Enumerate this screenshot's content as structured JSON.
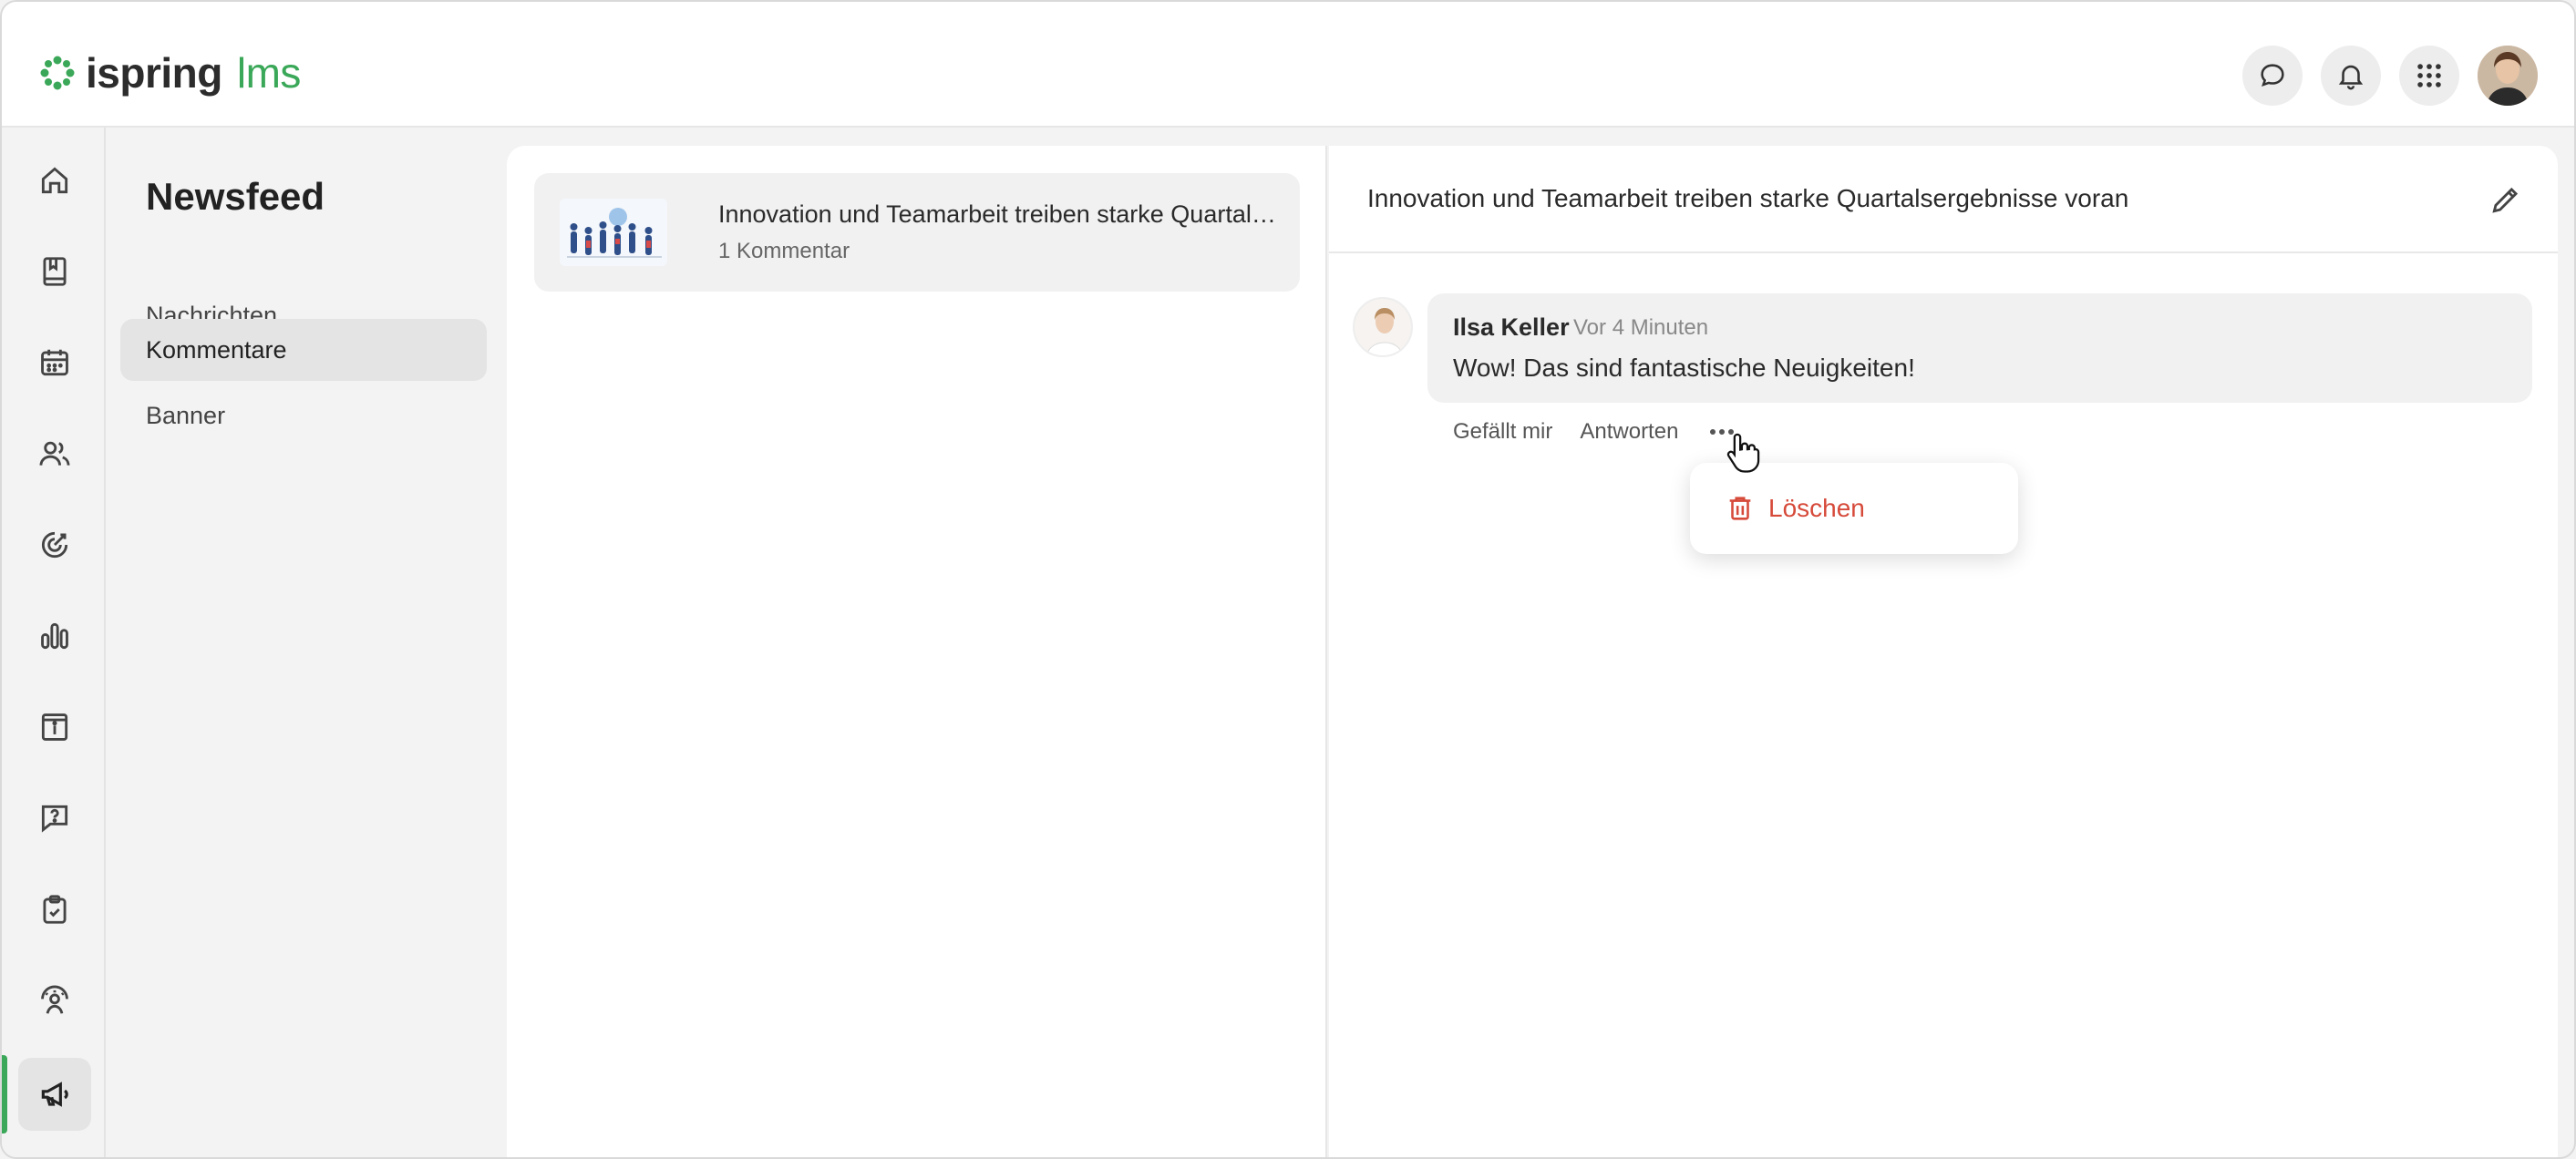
{
  "app": {
    "logo_part1": "ispring",
    "logo_part2": "lms",
    "accent_color": "#3aa858",
    "danger_color": "#d64a3a"
  },
  "header": {
    "icons": [
      "chat-icon",
      "bell-icon",
      "apps-grid-icon",
      "user-avatar"
    ]
  },
  "rail": {
    "items": [
      {
        "icon": "home-icon"
      },
      {
        "icon": "book-icon"
      },
      {
        "icon": "calendar-icon"
      },
      {
        "icon": "users-icon"
      },
      {
        "icon": "target-icon"
      },
      {
        "icon": "bar-chart-icon"
      },
      {
        "icon": "info-board-icon"
      },
      {
        "icon": "help-chat-icon"
      },
      {
        "icon": "clipboard-check-icon"
      },
      {
        "icon": "user-gauge-icon"
      },
      {
        "icon": "megaphone-icon",
        "active": true
      }
    ]
  },
  "section": {
    "title": "Newsfeed",
    "items": [
      {
        "label": "Nachrichten",
        "selected": false
      },
      {
        "label": "Kommentare",
        "selected": true
      },
      {
        "label": "Banner",
        "selected": false
      }
    ]
  },
  "list": {
    "items": [
      {
        "title": "Innovation und Teamarbeit treiben starke Quartalsergebnisse voran",
        "subtitle": "1 Kommentar"
      }
    ]
  },
  "detail": {
    "title": "Innovation und Teamarbeit treiben starke Quartalsergebnisse voran",
    "comment": {
      "author": "Ilsa Keller",
      "time": "Vor 4 Minuten",
      "text": "Wow! Das sind fantastische Neuigkeiten!",
      "actions": {
        "like": "Gefällt mir",
        "reply": "Antworten"
      }
    },
    "menu": {
      "delete_label": "Löschen"
    }
  }
}
